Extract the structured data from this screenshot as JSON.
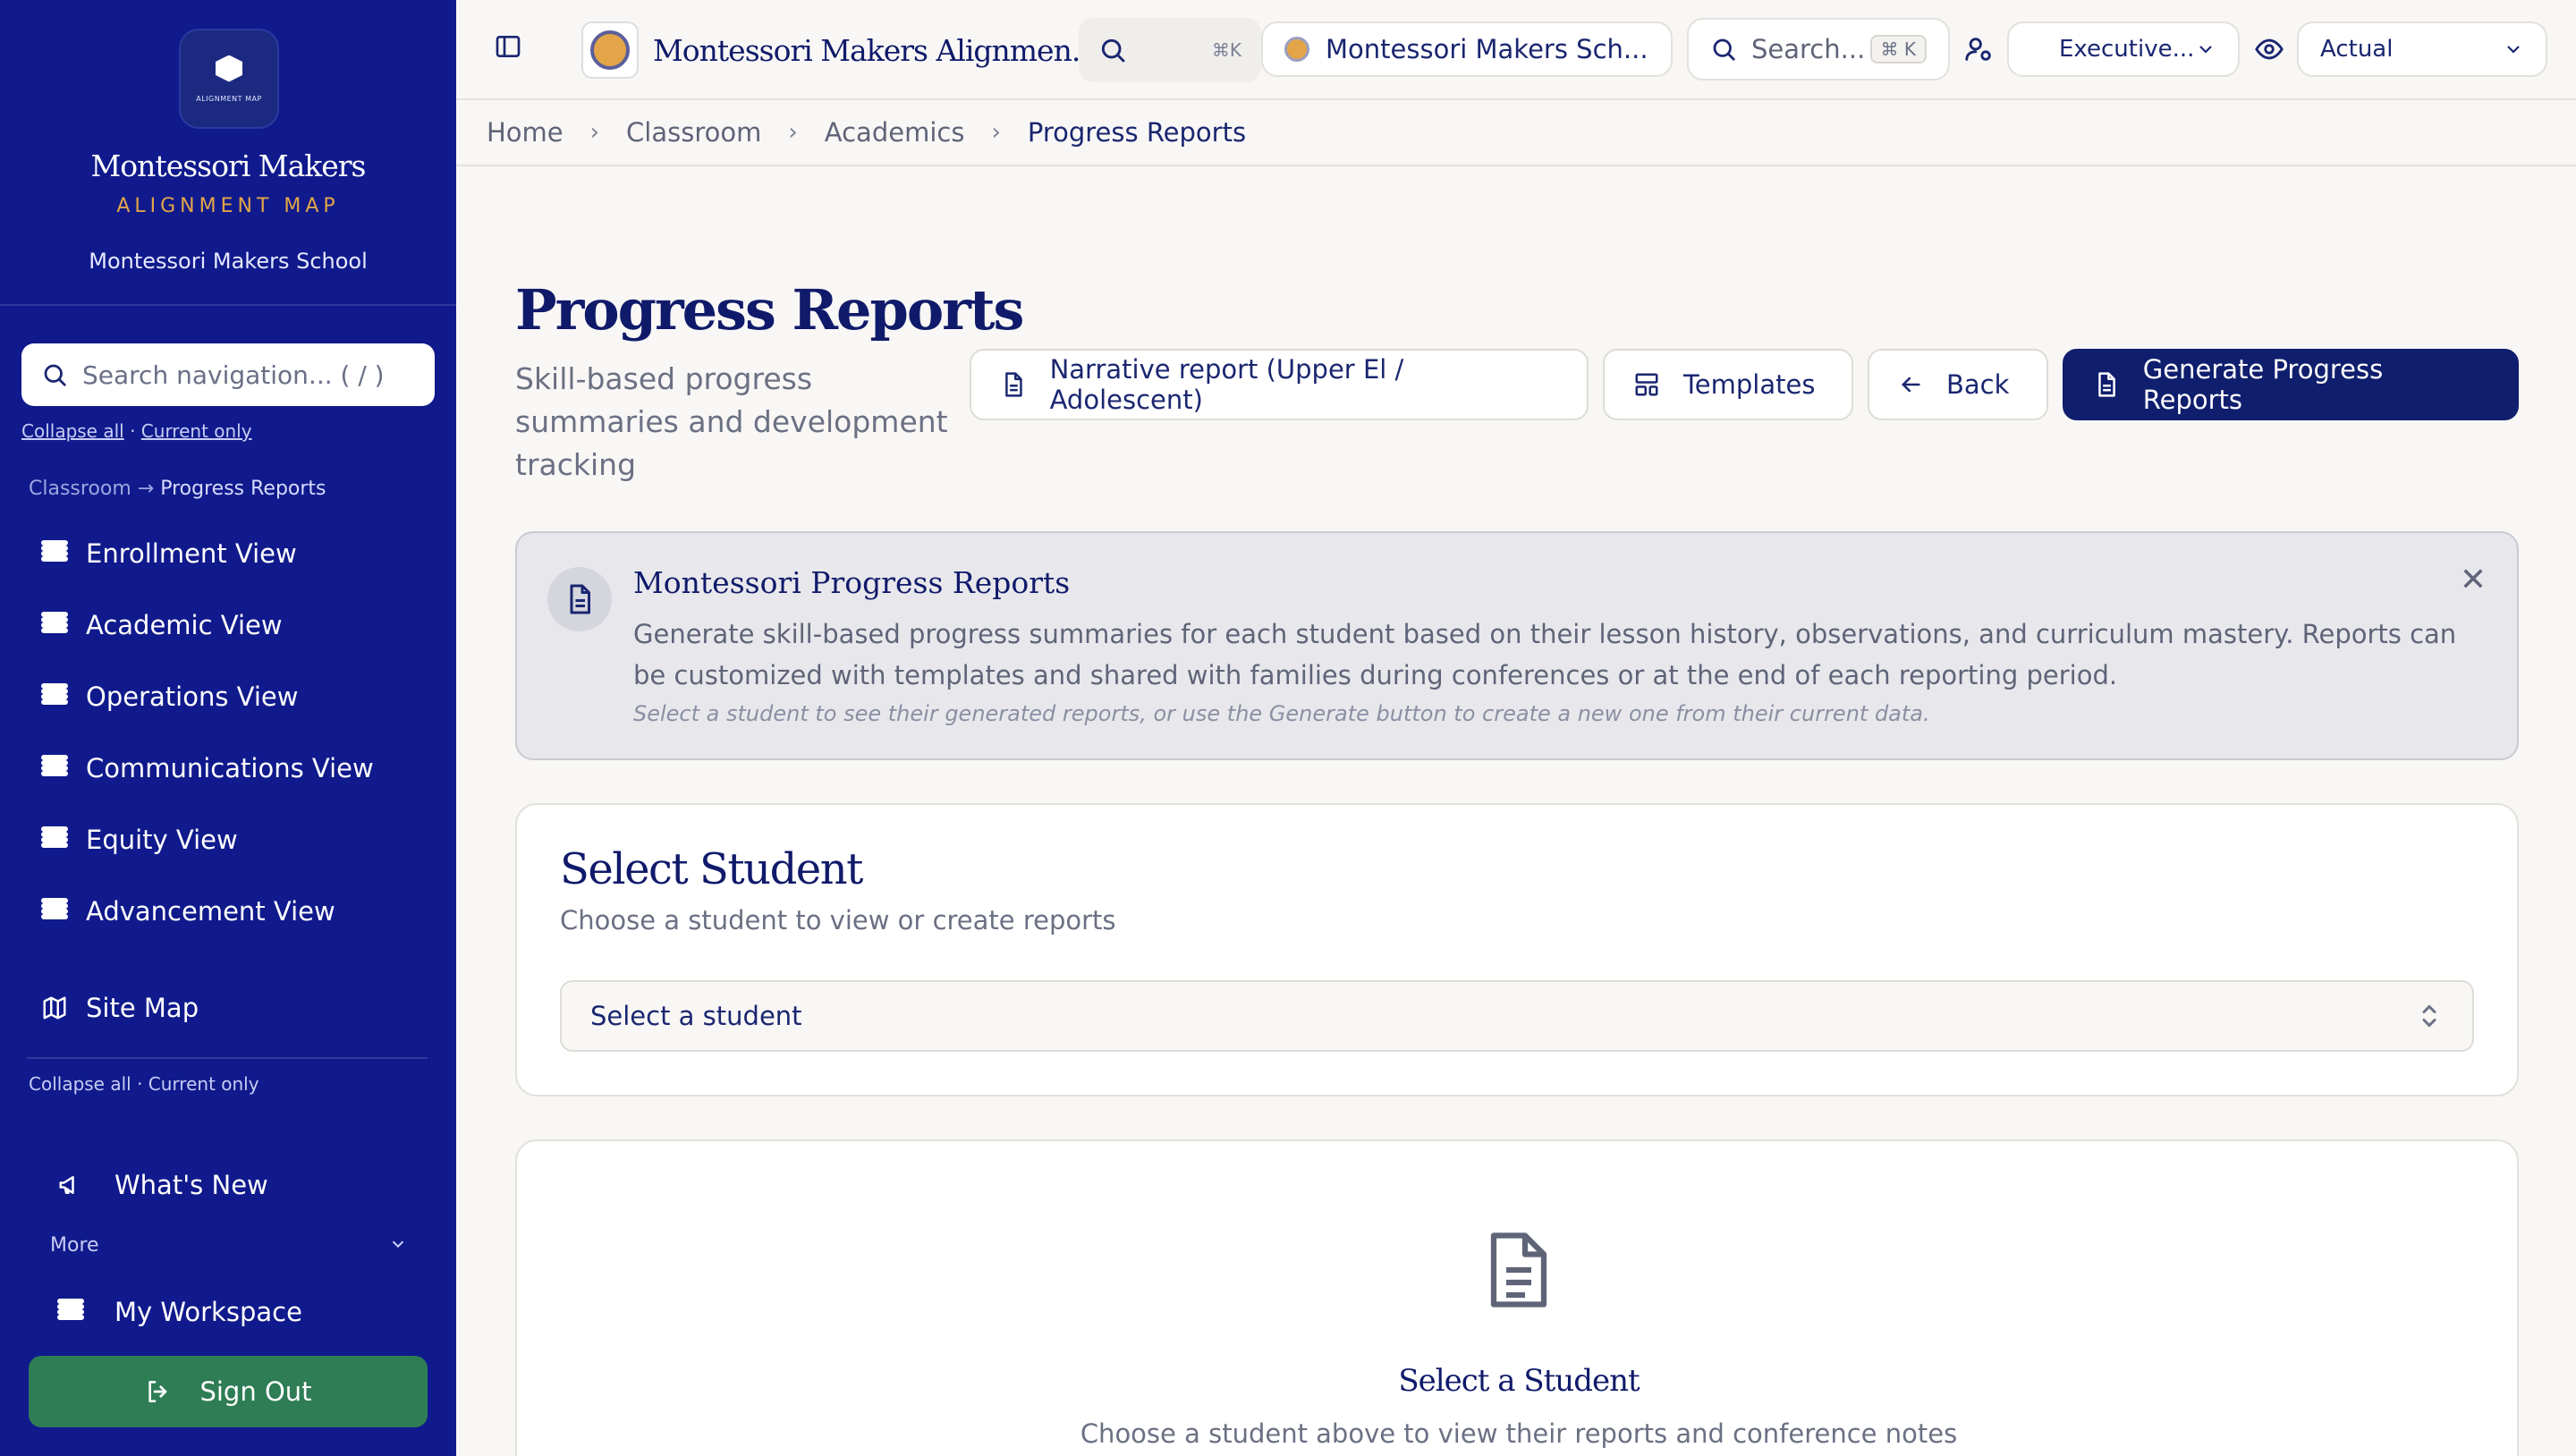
{
  "sidebar": {
    "logo_text": "ALIGNMENT MAP",
    "brand_name": "Montessori Makers",
    "brand_sub": "ALIGNMENT MAP",
    "school": "Montessori Makers School",
    "search_placeholder": "Search navigation... ( / )",
    "collapse_all": "Collapse all",
    "current_only": "Current only",
    "breadcrumb_parent": "Classroom",
    "breadcrumb_arrow": "→",
    "breadcrumb_current": "Progress Reports",
    "items": [
      {
        "label": "Enrollment View",
        "icon": "grid-icon"
      },
      {
        "label": "Academic View",
        "icon": "grid-icon"
      },
      {
        "label": "Operations View",
        "icon": "grid-icon"
      },
      {
        "label": "Communications View",
        "icon": "grid-icon"
      },
      {
        "label": "Equity View",
        "icon": "grid-icon"
      },
      {
        "label": "Advancement View",
        "icon": "grid-icon"
      }
    ],
    "site_map": "Site Map",
    "whats_new": "What's New",
    "more": "More",
    "my_workspace": "My Workspace",
    "sign_out": "Sign Out"
  },
  "topbar": {
    "app_title": "Montessori Makers Alignmen...",
    "search_shortcut": "⌘K",
    "school_selector": "Montessori Makers Sch...",
    "search_placeholder": "Search...",
    "search_kbd": "⌘ K",
    "role": "Executive...",
    "view_mode": "Actual"
  },
  "breadcrumb": [
    "Home",
    "Classroom",
    "Academics",
    "Progress Reports"
  ],
  "page": {
    "title": "Progress Reports",
    "subtitle": "Skill-based progress summaries and development tracking",
    "buttons": {
      "narrative": "Narrative report (Upper El / Adolescent)",
      "templates": "Templates",
      "back": "Back",
      "generate": "Generate Progress Reports"
    }
  },
  "info": {
    "title": "Montessori Progress Reports",
    "body": "Generate skill-based progress summaries for each student based on their lesson history, observations, and curriculum mastery. Reports can be customized with templates and shared with families during conferences or at the end of each reporting period.",
    "note": "Select a student to see their generated reports, or use the Generate button to create a new one from their current data.",
    "close": "✕"
  },
  "select_card": {
    "title": "Select Student",
    "subtitle": "Choose a student to view or create reports",
    "select_value": "Select a student"
  },
  "empty": {
    "title": "Select a Student",
    "subtitle": "Choose a student above to view their reports and conference notes"
  },
  "colors": {
    "sidebar_bg": "#101a8c",
    "primary": "#101e6e",
    "accent_gold": "#e3a548",
    "sign_out": "#2e7d55"
  }
}
